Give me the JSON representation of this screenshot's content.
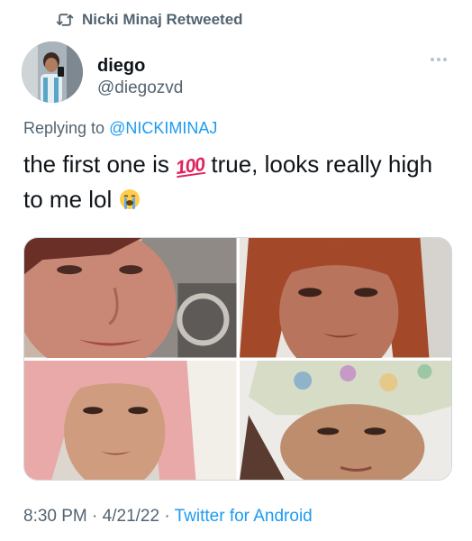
{
  "retweet": {
    "icon": "retweet-icon",
    "label": "Nicki Minaj Retweeted"
  },
  "author": {
    "display_name": "diego",
    "handle": "@diegozvd"
  },
  "reply": {
    "prefix": "Replying to",
    "mention": "@NICKIMINAJ"
  },
  "tweet": {
    "text_before_emoji": "the first one is ",
    "emoji_hundred": "100",
    "text_after_emoji": " true, looks really high to me lol "
  },
  "media": [
    {
      "name": "photo-1"
    },
    {
      "name": "photo-2"
    },
    {
      "name": "photo-3"
    },
    {
      "name": "photo-4"
    }
  ],
  "meta": {
    "time": "8:30 PM",
    "separator": " · ",
    "date": "4/21/22",
    "source": "Twitter for Android"
  },
  "colors": {
    "accent": "#1d9bf0",
    "secondary_text": "#536471",
    "primary_text": "#0f1419"
  }
}
